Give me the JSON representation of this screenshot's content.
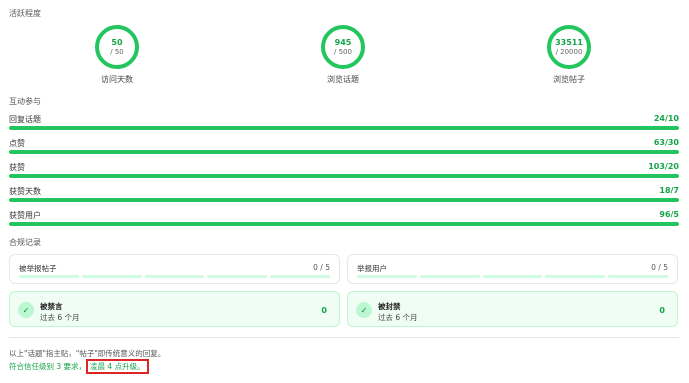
{
  "activity": {
    "title": "活跃程度",
    "items": [
      {
        "value": "50",
        "max": "/ 50",
        "label": "访问天数"
      },
      {
        "value": "945",
        "max": "/ 500",
        "label": "浏览话题"
      },
      {
        "value": "33511",
        "max": "/ 20000",
        "label": "浏览帖子"
      }
    ]
  },
  "interaction": {
    "title": "互动参与",
    "metrics": [
      {
        "label": "回复话题",
        "value": "24/10",
        "progress": 1.0
      },
      {
        "label": "点赞",
        "value": "63/30",
        "progress": 1.0
      },
      {
        "label": "获赞",
        "value": "103/20",
        "progress": 1.0
      },
      {
        "label": "获赞天数",
        "value": "18/7",
        "progress": 1.0
      },
      {
        "label": "获赞用户",
        "value": "96/5",
        "progress": 1.0
      }
    ]
  },
  "compliance": {
    "title": "合规记录",
    "flagged_posts": {
      "label": "被举报帖子",
      "value": "0 / 5"
    },
    "flagged_users": {
      "label": "举报用户",
      "value": "0 / 5"
    },
    "silenced": {
      "title": "被禁言",
      "subtitle": "过去 6 个月",
      "value": "0"
    },
    "suspended": {
      "title": "被封禁",
      "subtitle": "过去 6 个月",
      "value": "0"
    }
  },
  "footer": {
    "note": "以上\"话题\"指主贴，\"帖子\"即传统意义的回复。",
    "summary_prefix": "符合信任级别 3 要求，",
    "summary_highlight": "凌晨 4 点升级。"
  },
  "colors": {
    "accent": "#22c55e",
    "accent_dark": "#16a34a",
    "track": "#d1fae5",
    "highlight_border": "#dc2626"
  }
}
